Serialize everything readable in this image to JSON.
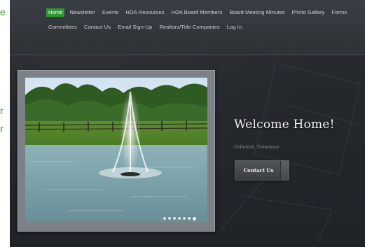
{
  "edge_text": [
    "e",
    "r",
    "r"
  ],
  "nav": {
    "items": [
      {
        "label": "Home",
        "active": true
      },
      {
        "label": "Newsletter",
        "active": false
      },
      {
        "label": "Events",
        "active": false
      },
      {
        "label": "HOA Resources",
        "active": false
      },
      {
        "label": "HOA Board Members",
        "active": false
      },
      {
        "label": "Board Meeting Minutes",
        "active": false
      },
      {
        "label": "Photo Gallery",
        "active": false
      },
      {
        "label": "Forms",
        "active": false
      },
      {
        "label": "Committees",
        "active": false
      },
      {
        "label": "Contact Us",
        "active": false
      },
      {
        "label": "Email Sign-Up",
        "active": false
      },
      {
        "label": "Realtors/Title Companies",
        "active": false
      },
      {
        "label": "Log In",
        "active": false
      }
    ]
  },
  "slider": {
    "image_subject": "pond with fountain",
    "dot_count": 7,
    "active_dot": 7
  },
  "hero": {
    "title": "Welcome Home!",
    "location": "Ooltewah, Tennessee",
    "button_label": "Contact Us"
  },
  "colors": {
    "accent": "#2f9a34",
    "background": "#24282d",
    "edge_text": "#2f9a2f"
  }
}
